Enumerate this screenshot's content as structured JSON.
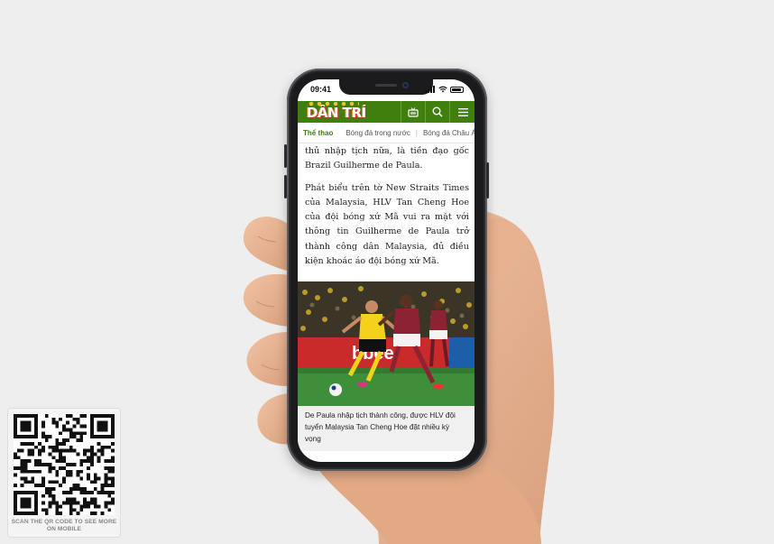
{
  "status_bar": {
    "time": "09:41"
  },
  "site": {
    "logo_text": "DÂN TRÍ"
  },
  "breadcrumb": {
    "items": [
      "Thể thao",
      "Bóng đá trong nước",
      "Bóng đá Châu Á"
    ]
  },
  "article": {
    "paragraphs": [
      "thủ nhập tịch nữa, là tiền đạo gốc Brazil Guilherme de Paula.",
      "Phát biểu trên tờ New Straits Times của Malaysia, HLV Tan Cheng Hoe của đội bóng xứ Mã vui ra mặt với thông tin Guilherme de Paula trở thành công dân Malaysia, đủ điều kiện khoác áo đội bóng xứ Mã."
    ],
    "photo_caption": "De Paula nhập tịch thành công, được HLV đội tuyển Malaysia Tan Cheng Hoe đặt nhiều kỳ vọng",
    "photo_banner_text": "bbee"
  },
  "qr": {
    "label": "SCAN THE QR CODE TO SEE MORE ON MOBILE"
  },
  "colors": {
    "brand_green": "#3f7f0e",
    "skin": "#e9b594",
    "frame": "#1b1b1d"
  },
  "icons": [
    "tv-icon",
    "search-icon",
    "menu-icon",
    "chevron-right-icon",
    "signal-icon",
    "wifi-icon",
    "battery-icon"
  ]
}
